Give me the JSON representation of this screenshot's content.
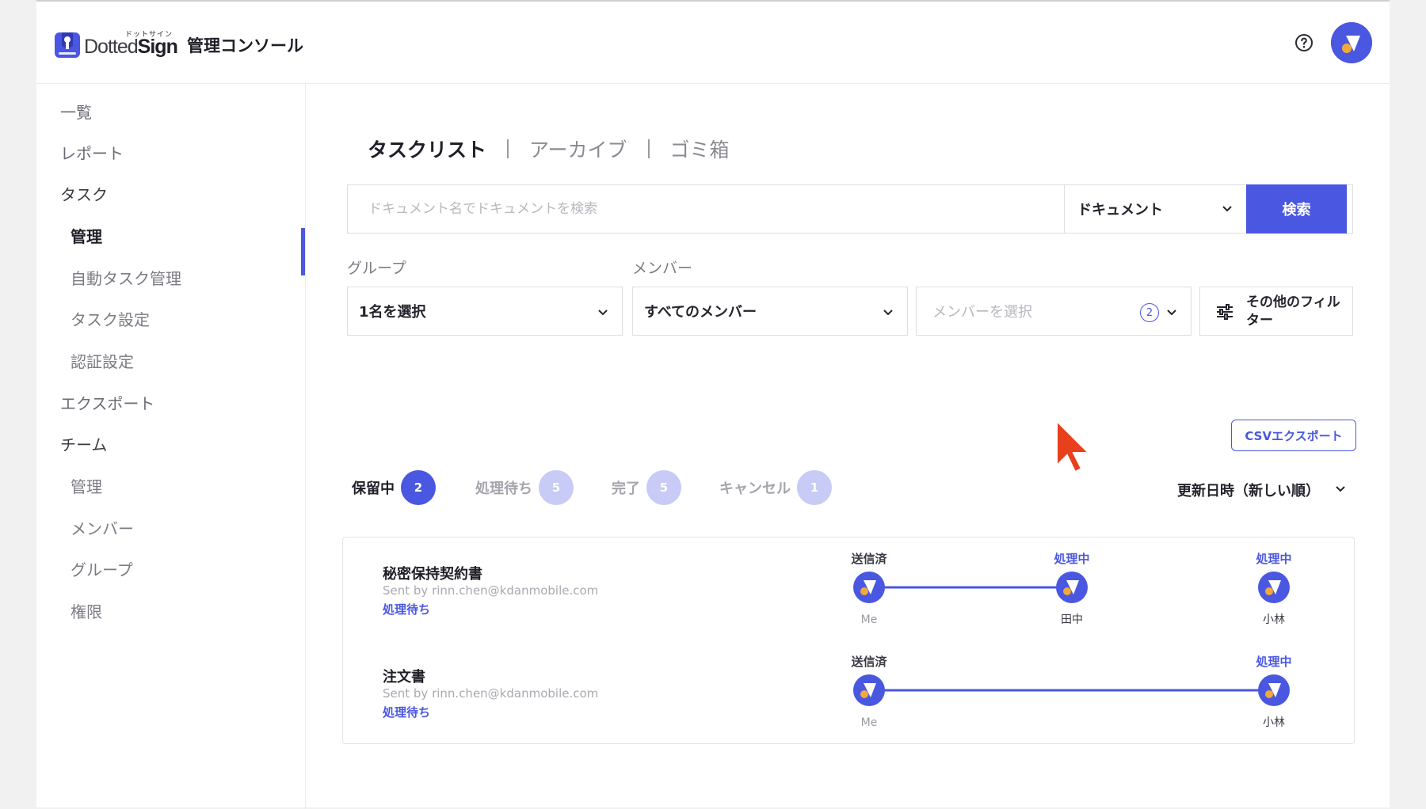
{
  "header": {
    "logo_ruby": "ドットサイン",
    "logo_word_a": "Dotted",
    "logo_word_b": "Sign",
    "app_title": "管理コンソール",
    "help_icon": "question-circle-icon",
    "avatar_icon": "user-avatar-icon"
  },
  "sidebar": {
    "items": [
      {
        "label": "一覧"
      },
      {
        "label": "レポート"
      },
      {
        "label": "タスク"
      },
      {
        "label": "管理"
      },
      {
        "label": "自動タスク管理"
      },
      {
        "label": "タスク設定"
      },
      {
        "label": "認証設定"
      },
      {
        "label": "エクスポート"
      },
      {
        "label": "チーム"
      },
      {
        "label": "管理"
      },
      {
        "label": "メンバー"
      },
      {
        "label": "グループ"
      },
      {
        "label": "権限"
      }
    ],
    "active_item": "タスク / 管理"
  },
  "tabs": [
    {
      "label": "タスクリスト"
    },
    {
      "label": "アーカイブ"
    },
    {
      "label": "ゴミ箱"
    }
  ],
  "search": {
    "placeholder": "ドキュメント名でドキュメントを検索",
    "type_value": "ドキュメント",
    "button": "検索"
  },
  "filters": {
    "group_label": "グループ",
    "group_value": "1名を選択",
    "member_label": "メンバー",
    "member_value": "すべてのメンバー",
    "member_select_placeholder": "メンバーを選択",
    "member_count": "2",
    "more_filters": "その他のフィルター"
  },
  "csv_export": "CSVエクスポート",
  "status_tabs": [
    {
      "label": "保留中",
      "count": "2"
    },
    {
      "label": "処理待ち",
      "count": "5"
    },
    {
      "label": "完了",
      "count": "5"
    },
    {
      "label": "キャンセル",
      "count": "1"
    }
  ],
  "sort": "更新日時（新しい順）",
  "tasks": [
    {
      "title": "秘密保持契約書",
      "sender": "Sent by rinn.chen@kdanmobile.com",
      "status": "処理待ち",
      "steps": [
        {
          "state": "送信済",
          "name": "Me"
        },
        {
          "state": "処理中",
          "name": "田中"
        },
        {
          "state": "処理中",
          "name": "小林"
        }
      ]
    },
    {
      "title": "注文書",
      "sender": "Sent by rinn.chen@kdanmobile.com",
      "status": "処理待ち",
      "steps": [
        {
          "state": "送信済",
          "name": "Me"
        },
        {
          "state": "処理中",
          "name": "小林"
        }
      ]
    }
  ],
  "colors": {
    "accent": "#4a57e0",
    "accent_light": "#c7cbf5",
    "avatar_dot": "#f2a93b",
    "cursor": "#e8401c"
  }
}
